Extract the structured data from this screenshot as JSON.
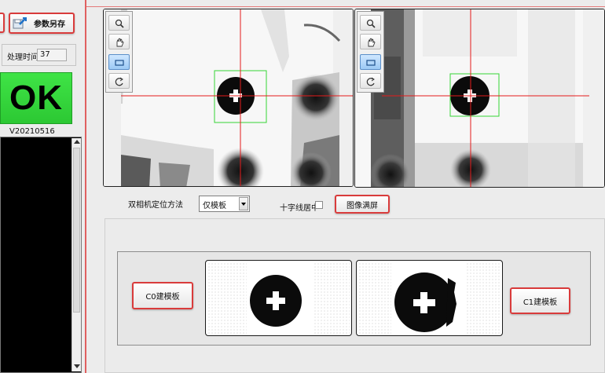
{
  "left_panel": {
    "save_params_label": "参数另存",
    "processing_time_label": "处理时间",
    "processing_time_value": "37",
    "result_text": "OK",
    "version": "V20210516"
  },
  "camera_views": {
    "tools": [
      "zoom-icon",
      "pan-hand-icon",
      "rectangle-roi-icon",
      "rotate-icon"
    ]
  },
  "controls": {
    "locate_method_label": "双相机定位方法",
    "locate_method_value": "仅模板",
    "crosshair_center_label": "十字线居中",
    "crosshair_center_checked": false,
    "fullscreen_label": "图像满屏"
  },
  "templates": {
    "c0_button_label": "C0建模板",
    "c1_button_label": "C1建模板"
  },
  "colors": {
    "ok_green": "#33d63a",
    "crosshair_red": "#e51b1b",
    "roi_green": "#35d635",
    "button_border_red": "#d93b3b"
  }
}
